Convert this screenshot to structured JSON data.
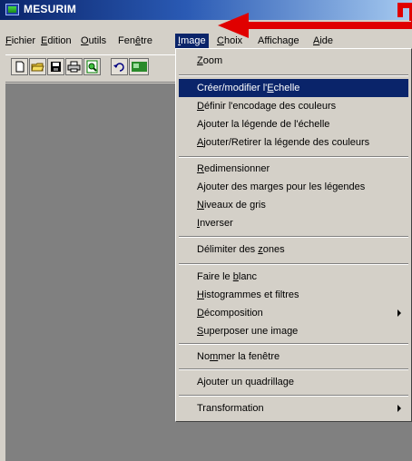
{
  "window": {
    "title": "MESURIM"
  },
  "menubar": [
    {
      "pre": "",
      "ul": "F",
      "post": "ichier"
    },
    {
      "pre": "",
      "ul": "E",
      "post": "dition"
    },
    {
      "pre": "",
      "ul": "O",
      "post": "utils"
    },
    {
      "pre": "Fen",
      "ul": "ê",
      "post": "tre"
    },
    {
      "pre": "",
      "ul": "I",
      "post": "mage"
    },
    {
      "pre": "",
      "ul": "C",
      "post": "hoix"
    },
    {
      "pre": "",
      "ul": "",
      "post": "Affichage"
    },
    {
      "pre": "",
      "ul": "A",
      "post": "ide"
    }
  ],
  "toolbar": {
    "buttons": [
      "new-file-icon",
      "open-folder-icon",
      "save-icon",
      "print-icon",
      "print-preview-icon",
      "undo-icon",
      "image-icon"
    ]
  },
  "image_menu": {
    "items": [
      {
        "pre": "",
        "ul": "Z",
        "post": "oom"
      },
      {
        "pre": "Créer/modifier l'",
        "ul": "E",
        "post": "chelle"
      },
      {
        "pre": "",
        "ul": "D",
        "post": "éfinir l'encodage des couleurs"
      },
      {
        "pre": "",
        "ul": "",
        "post": "Ajouter la légende de l'échelle"
      },
      {
        "pre": "",
        "ul": "A",
        "post": "jouter/Retirer la légende des couleurs"
      },
      {
        "pre": "",
        "ul": "R",
        "post": "edimensionner"
      },
      {
        "pre": "",
        "ul": "",
        "post": "Ajouter des marges pour les légendes"
      },
      {
        "pre": "",
        "ul": "N",
        "post": "iveaux de gris"
      },
      {
        "pre": "",
        "ul": "I",
        "post": "nverser"
      },
      {
        "pre": "Délimiter des ",
        "ul": "z",
        "post": "ones"
      },
      {
        "pre": "Faire le ",
        "ul": "b",
        "post": "lanc"
      },
      {
        "pre": "",
        "ul": "H",
        "post": "istogrammes et filtres"
      },
      {
        "pre": "",
        "ul": "D",
        "post": "écomposition"
      },
      {
        "pre": "",
        "ul": "S",
        "post": "uperposer une image"
      },
      {
        "pre": "No",
        "ul": "m",
        "post": "mer la fenêtre"
      },
      {
        "pre": "",
        "ul": "",
        "post": "Ajouter un quadrillage"
      },
      {
        "pre": "",
        "ul": "",
        "post": "Transformation"
      }
    ]
  },
  "colors": {
    "title_bar": "#0a246a",
    "highlight": "#0a246a",
    "face": "#d4d0c8",
    "workspace": "#808080",
    "annotation_arrow": "#e00000"
  }
}
